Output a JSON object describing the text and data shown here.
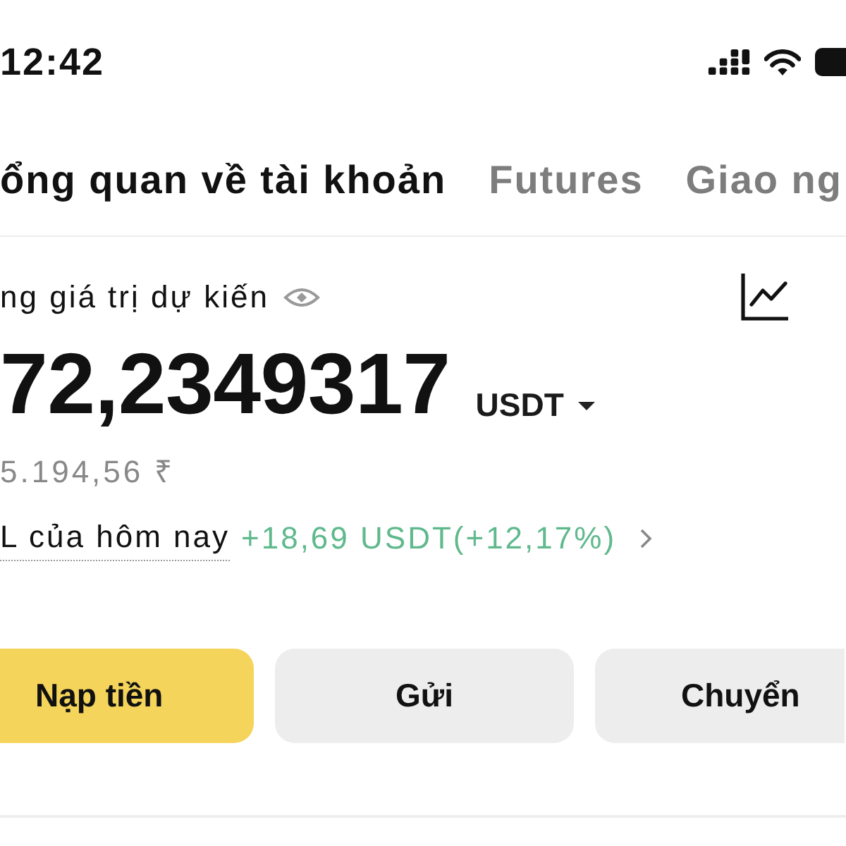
{
  "status_bar": {
    "time": "12:42"
  },
  "tabs": [
    {
      "label": "ổng quan về tài khoản",
      "selected": true
    },
    {
      "label": "Futures",
      "selected": false
    },
    {
      "label": "Giao ng",
      "selected": false
    }
  ],
  "balance": {
    "label": "ng giá trị dự kiến",
    "amount": "72,2349317",
    "currency": "USDT",
    "converted": "5.194,56 ₹",
    "pnl_label": "L của hôm nay",
    "pnl_value": "+18,69 USDT(+12,17%)"
  },
  "actions": [
    {
      "label": "Nạp tiền",
      "kind": "primary"
    },
    {
      "label": "Gửi",
      "kind": "secondary"
    },
    {
      "label": "Chuyển",
      "kind": "secondary"
    }
  ]
}
